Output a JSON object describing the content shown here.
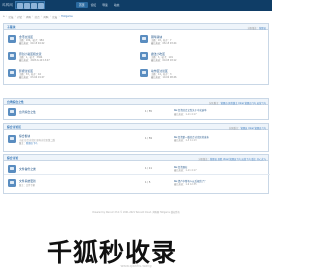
{
  "brand": {
    "logo_text": "鸡鸭网",
    "logo_sub": "ziyu.com"
  },
  "nav": {
    "items": [
      "首页",
      "论坛",
      "导读",
      "动态"
    ]
  },
  "breadcrumb": {
    "items": [
      "论坛",
      "讨论",
      "鸡鸭",
      "综合",
      "鸡鸭",
      "论坛",
      "Hollgarou"
    ],
    "current": "Hollgarou"
  },
  "section1": {
    "title": "子版块",
    "right": "分区版主：",
    "right_mods": "管理员",
    "forums": [
      {
        "name": "金币交流区",
        "stats": "主题：184，帖子：984",
        "last": "最后发表：09-15 04:22"
      },
      {
        "name": "钢琴版块",
        "stats": "主题：18，帖子：7",
        "last": "最后发表：08-15 03:44"
      },
      {
        "name": "原创小说区和交流",
        "stats": "主题：1，帖子：3364",
        "last": "最后发表：2023-6-10 13:47"
      },
      {
        "name": "魔法小吃区",
        "stats": "主题：3，帖子：191",
        "last": "最后发表：09-05 18:12"
      },
      {
        "name": "影视讨论区",
        "stats": "主题：33，帖子：16",
        "last": "最后发表：03-04 19:27"
      },
      {
        "name": "动作区讨论区",
        "stats": "主题：14，帖子：3",
        "last": "最后发表：10-02 08:46"
      }
    ]
  },
  "section2": {
    "title": "台湾综合之性",
    "right": "分区版主：",
    "right_mods": "管理员 其他版主 Ukiel 管理员飞鸟 运营飞鸟",
    "rows": [
      {
        "name": "台湾综合之性",
        "count": "1 / 55",
        "last": "Re:台湾综合之性关于中式选举",
        "last_date": "最后发表：1-11 4:17"
      }
    ]
  },
  "section3": {
    "title": "综合讨论区",
    "right": "分区版主：",
    "right_mods": "管理员 Ukiel 管理员飞鸟",
    "rows": [
      {
        "name": "综合板块",
        "desc": "小说 综合讨论区 原有讨论区第二版",
        "mod_label": "版主：",
        "mods": "管理员飞鸟",
        "count": "1 / 59",
        "last": "Re:台湾第一版综合讨论区的发布",
        "last_date": "最后发表：1-5 11:13"
      }
    ]
  },
  "section4": {
    "title": "综合讨论",
    "right": "分区版主：",
    "right_mods": "管理员 其他 Ukiel 管理员飞鸟 运营飞鸟 版主 开心尤与",
    "rows": [
      {
        "name": "文件备份之类",
        "count": "1 / 11",
        "last": "Re:台湾现在",
        "last_date": "最后发表：1-11 4:17"
      },
      {
        "name": "文件系统更新",
        "desc": "版主：文件专家",
        "count": "1 / 5",
        "last": "Re:资产中所有人以后规范了？",
        "last_date": "最后发表：1-9 12:35"
      }
    ]
  },
  "footer": {
    "text": "Powered by Discuz! X3.4 © 2001-2021 Tencent Cloud. 鸡鸭网 Hollgarou 版权所有"
  },
  "watermark": {
    "text": "千狐秒收录",
    "url": "www.qianhu.wang"
  }
}
